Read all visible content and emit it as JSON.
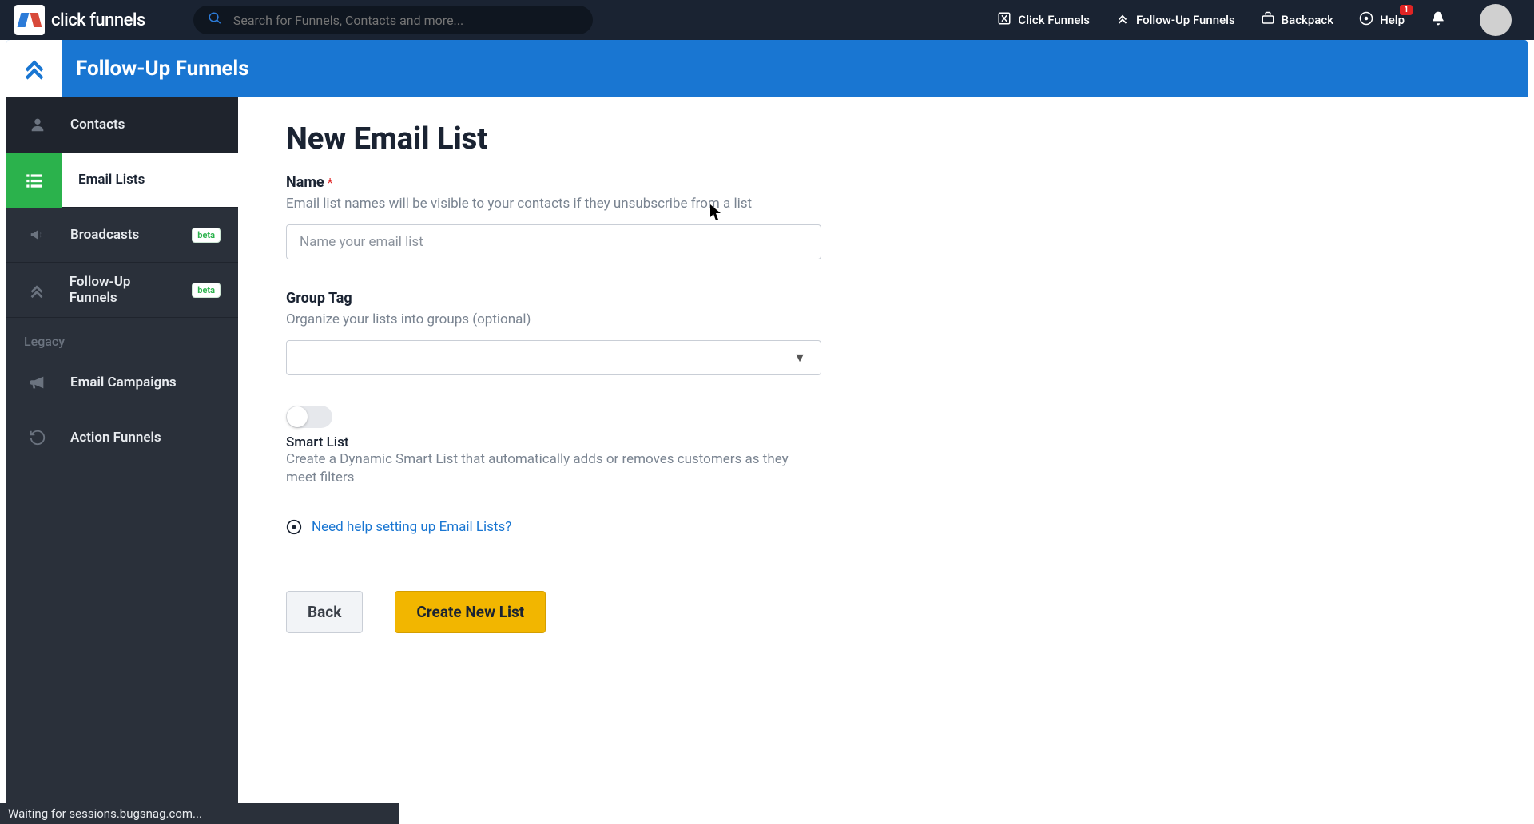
{
  "brand": "click funnels",
  "search": {
    "placeholder": "Search for Funnels, Contacts and more..."
  },
  "topnav": {
    "clickfunnels": "Click Funnels",
    "followup": "Follow-Up Funnels",
    "backpack": "Backpack",
    "help": "Help",
    "help_badge": "1"
  },
  "header": {
    "title": "Follow-Up Funnels"
  },
  "sidebar": {
    "contacts": "Contacts",
    "email_lists": "Email Lists",
    "broadcasts": "Broadcasts",
    "broadcasts_badge": "beta",
    "followup": "Follow-Up Funnels",
    "followup_badge": "beta",
    "legacy": "Legacy",
    "email_campaigns": "Email Campaigns",
    "action_funnels": "Action Funnels"
  },
  "page": {
    "title": "New Email List",
    "name_label": "Name",
    "name_help": "Email list names will be visible to your contacts if they unsubscribe from a list",
    "name_placeholder": "Name your email list",
    "group_label": "Group Tag",
    "group_help": "Organize your lists into groups (optional)",
    "smart_label": "Smart List",
    "smart_desc": "Create a Dynamic Smart List that automatically adds or removes customers as they meet filters",
    "help_link": "Need help setting up Email Lists?",
    "back": "Back",
    "create": "Create New List"
  },
  "status": "Waiting for sessions.bugsnag.com..."
}
